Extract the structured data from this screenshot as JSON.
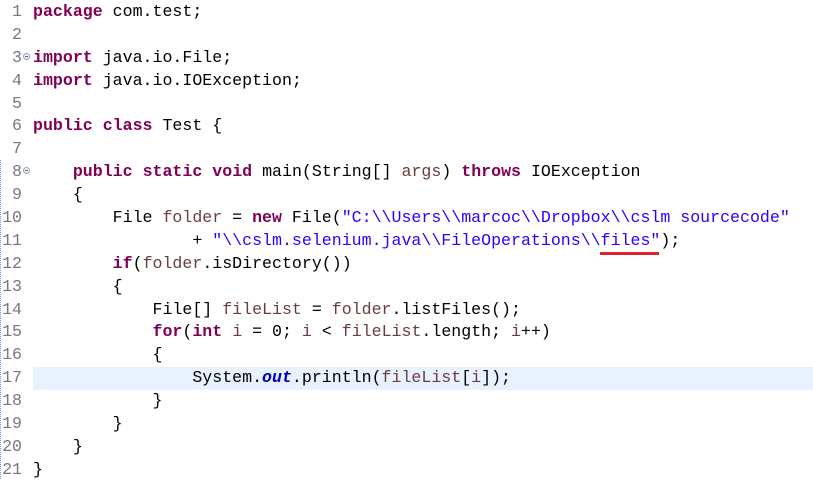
{
  "editor": {
    "current_line": 17,
    "error_word": "files",
    "colors": {
      "keyword": "#7f0055",
      "string": "#2a00ff",
      "local_variable": "#6a3e3e",
      "static_field": "#0000c0",
      "line_highlight": "#e8f2fe",
      "error_underline": "#e0202a"
    },
    "lines": [
      {
        "n": "1",
        "fold": false,
        "t": [
          [
            "kw",
            "package"
          ],
          [
            "plain",
            " com.test;"
          ]
        ]
      },
      {
        "n": "2",
        "fold": false,
        "t": []
      },
      {
        "n": "3",
        "fold": true,
        "t": [
          [
            "kw",
            "import"
          ],
          [
            "plain",
            " java.io.File;"
          ]
        ]
      },
      {
        "n": "4",
        "fold": false,
        "t": [
          [
            "kw",
            "import"
          ],
          [
            "plain",
            " java.io.IOException;"
          ]
        ]
      },
      {
        "n": "5",
        "fold": false,
        "t": []
      },
      {
        "n": "6",
        "fold": false,
        "t": [
          [
            "kw",
            "public"
          ],
          [
            "plain",
            " "
          ],
          [
            "kw",
            "class"
          ],
          [
            "plain",
            " Test {"
          ]
        ]
      },
      {
        "n": "7",
        "fold": false,
        "t": []
      },
      {
        "n": "8",
        "fold": true,
        "t": [
          [
            "plain",
            "    "
          ],
          [
            "kw",
            "public"
          ],
          [
            "plain",
            " "
          ],
          [
            "kw",
            "static"
          ],
          [
            "plain",
            " "
          ],
          [
            "kw",
            "void"
          ],
          [
            "plain",
            " main(String[] "
          ],
          [
            "var",
            "args"
          ],
          [
            "plain",
            ") "
          ],
          [
            "kw",
            "throws"
          ],
          [
            "plain",
            " IOException"
          ]
        ]
      },
      {
        "n": "9",
        "fold": false,
        "t": [
          [
            "plain",
            "    {"
          ]
        ]
      },
      {
        "n": "10",
        "fold": false,
        "t": [
          [
            "plain",
            "        File "
          ],
          [
            "var",
            "folder"
          ],
          [
            "plain",
            " = "
          ],
          [
            "kw",
            "new"
          ],
          [
            "plain",
            " File("
          ],
          [
            "str",
            "\"C:\\\\Users\\\\marcoc\\\\Dropbox\\\\cslm sourcecode\""
          ]
        ]
      },
      {
        "n": "11",
        "fold": false,
        "t": [
          [
            "plain",
            "                + "
          ],
          [
            "str",
            "\"\\\\cslm.selenium.java\\\\FileOperations\\\\files\""
          ],
          [
            "plain",
            ");"
          ]
        ]
      },
      {
        "n": "12",
        "fold": false,
        "t": [
          [
            "plain",
            "        "
          ],
          [
            "kw",
            "if"
          ],
          [
            "plain",
            "("
          ],
          [
            "var",
            "folder"
          ],
          [
            "plain",
            ".isDirectory())"
          ]
        ]
      },
      {
        "n": "13",
        "fold": false,
        "t": [
          [
            "plain",
            "        {"
          ]
        ]
      },
      {
        "n": "14",
        "fold": false,
        "t": [
          [
            "plain",
            "            File[] "
          ],
          [
            "var",
            "fileList"
          ],
          [
            "plain",
            " = "
          ],
          [
            "var",
            "folder"
          ],
          [
            "plain",
            ".listFiles();"
          ]
        ]
      },
      {
        "n": "15",
        "fold": false,
        "t": [
          [
            "plain",
            "            "
          ],
          [
            "kw",
            "for"
          ],
          [
            "plain",
            "("
          ],
          [
            "kw",
            "int"
          ],
          [
            "plain",
            " "
          ],
          [
            "var",
            "i"
          ],
          [
            "plain",
            " = 0; "
          ],
          [
            "var",
            "i"
          ],
          [
            "plain",
            " < "
          ],
          [
            "var",
            "fileList"
          ],
          [
            "plain",
            ".length; "
          ],
          [
            "var",
            "i"
          ],
          [
            "plain",
            "++)"
          ]
        ]
      },
      {
        "n": "16",
        "fold": false,
        "t": [
          [
            "plain",
            "            {"
          ]
        ]
      },
      {
        "n": "17",
        "fold": false,
        "t": [
          [
            "plain",
            "                System."
          ],
          [
            "fld",
            "out"
          ],
          [
            "plain",
            ".println("
          ],
          [
            "var",
            "fileList"
          ],
          [
            "plain",
            "["
          ],
          [
            "var",
            "i"
          ],
          [
            "plain",
            "]);"
          ]
        ]
      },
      {
        "n": "18",
        "fold": false,
        "t": [
          [
            "plain",
            "            }"
          ]
        ]
      },
      {
        "n": "19",
        "fold": false,
        "t": [
          [
            "plain",
            "        }"
          ]
        ]
      },
      {
        "n": "20",
        "fold": false,
        "t": [
          [
            "plain",
            "    }"
          ]
        ]
      },
      {
        "n": "21",
        "fold": false,
        "t": [
          [
            "plain",
            "}"
          ]
        ]
      }
    ]
  }
}
